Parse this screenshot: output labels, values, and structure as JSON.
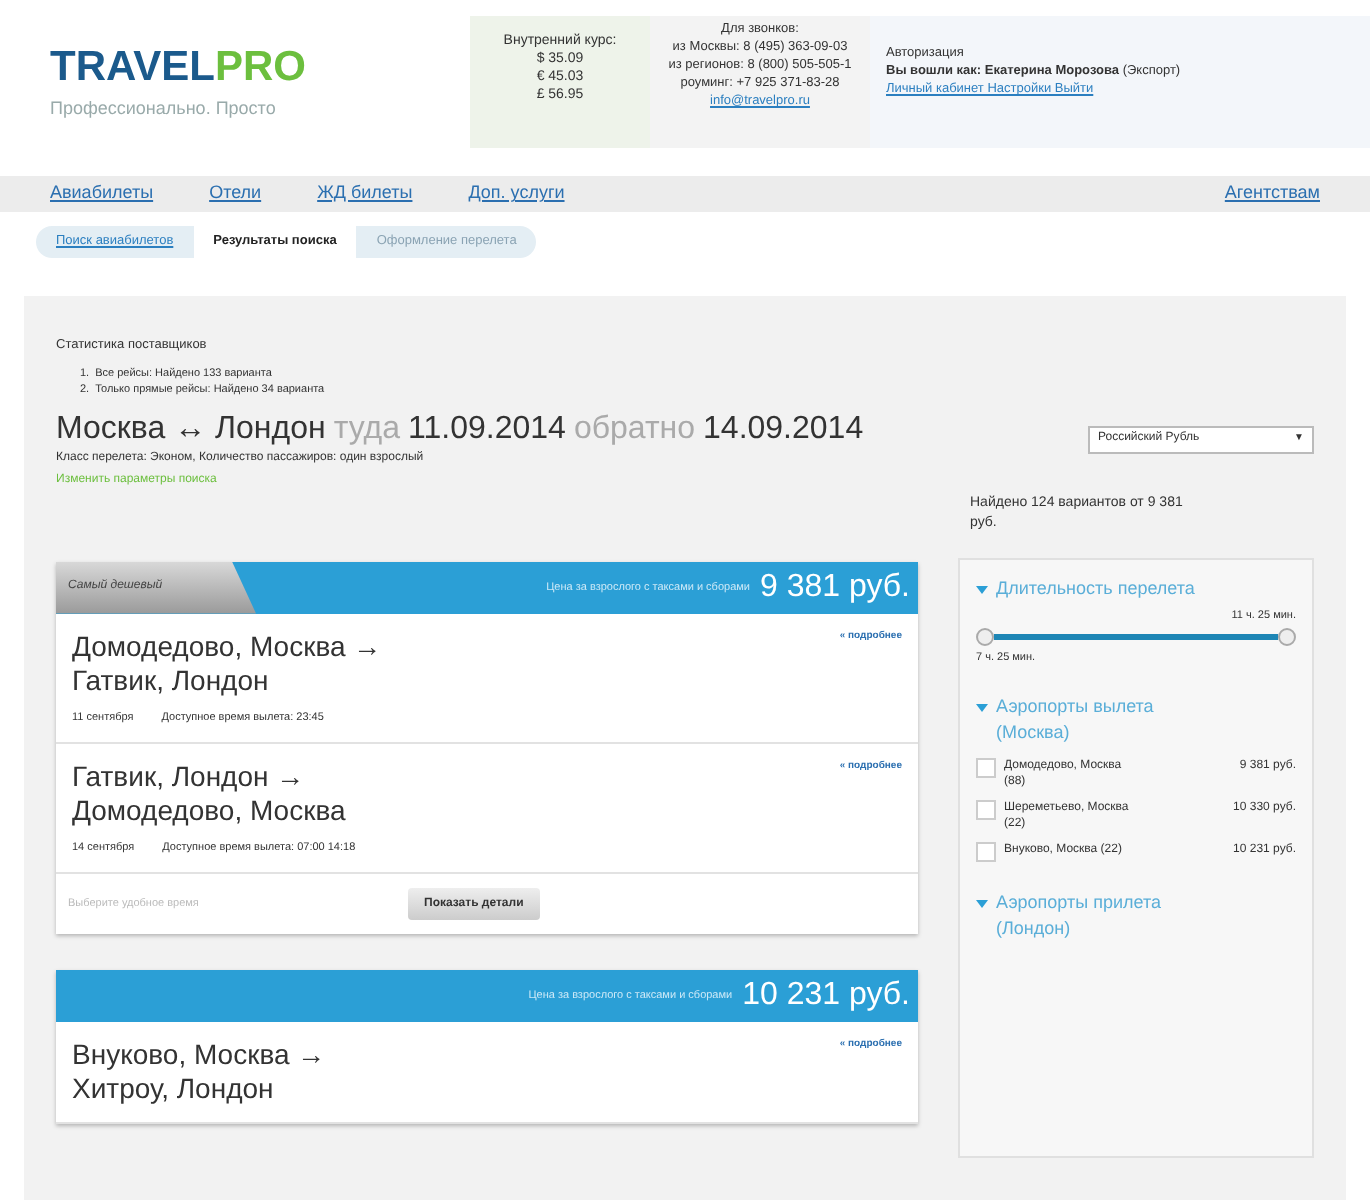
{
  "logo": {
    "part_1": "TRAVEL",
    "part_2": "PRO",
    "tagline": "Профессионально. Просто"
  },
  "rates": {
    "title": "Внутренний курс:",
    "lines": [
      "$ 35.09",
      "€ 45.03",
      "£ 56.95"
    ]
  },
  "contacts": {
    "title": "Для звонков:",
    "lines": [
      "из Москвы: 8 (495) 363-09-03",
      "из регионов: 8 (800) 505-505-1",
      "роуминг: +7 925 371-83-28"
    ],
    "email": "info@travelpro.ru"
  },
  "auth": {
    "title": "Авторизация",
    "label": "Вы вошли как:",
    "user": "Екатерина Морозова",
    "org": "(Экспорт)",
    "links": "Личный кабинет Настройки Выйти"
  },
  "nav": {
    "items": [
      "Авиабилеты",
      "Отели",
      "ЖД билеты",
      "Доп. услуги"
    ],
    "right": "Агентствам"
  },
  "breadcrumbs": [
    {
      "label": "Поиск авиабилетов",
      "selected": false,
      "disabled": false
    },
    {
      "label": "Результаты поиска",
      "selected": true,
      "disabled": false
    },
    {
      "label": "Оформление перелета",
      "selected": false,
      "disabled": true
    }
  ],
  "stats": {
    "title": "Статистика поставщиков",
    "items": [
      {
        "number": "1.",
        "text": "Все рейсы: Найдено 133 варианта"
      },
      {
        "number": "2.",
        "text": "Только прямые рейсы: Найдено 34 варианта"
      }
    ]
  },
  "route": {
    "from_to": "Москва ↔ Лондон",
    "there_label": "туда",
    "there_date": "11.09.2014",
    "back_label": "обратно",
    "back_date": "14.09.2014",
    "details": "Класс перелета: Эконом, Количество пассажиров: один взрослый",
    "change_link": "Изменить параметры поиска"
  },
  "currency": {
    "value": "Российский Рубль",
    "arrow": "▼"
  },
  "found": "Найдено 124 вариантов от 9 381 руб.",
  "offers": [
    {
      "tag": "Самый дешевый",
      "price_label": "Цена за взрослого с таксами и сборами",
      "price": "9 381 руб.",
      "segments": [
        {
          "route_1": "Домодедово, Москва →",
          "route_2": "Гатвик, Лондон",
          "link": "« подробнее",
          "date": "11 сентября",
          "times": "Доступное время вылета: 23:45"
        },
        {
          "route_1": "Гатвик, Лондон →",
          "route_2": "Домодедово, Москва",
          "link": "« подробнее",
          "date": "14 сентября",
          "times": "Доступное время вылета: 07:00 14:18"
        }
      ],
      "footer_note": "Выберите удобное время",
      "button": "Показать детали"
    },
    {
      "price_label": "Цена за взрослого с таксами и сборами",
      "price": "10 231 руб.",
      "segments": [
        {
          "route_1": "Внуково, Москва →",
          "route_2": "Хитроу, Лондон",
          "link": "« подробнее"
        }
      ]
    }
  ],
  "filters": [
    {
      "kind": "slider",
      "title": "Длительность перелета",
      "expanded": true,
      "max_label": "11 ч. 25 мин.",
      "min_label": "7 ч. 25 мин.",
      "level": 1
    },
    {
      "kind": "checklist",
      "title": "Аэропорты вылета (Москва)",
      "expanded": true,
      "options": [
        {
          "label": "Домодедово, Москва (88)",
          "price": "9 381 руб.",
          "checked": false
        },
        {
          "label": "Шереметьево, Москва (22)",
          "price": "10 330 руб.",
          "checked": false
        },
        {
          "label": "Внуково, Москва (22)",
          "price": "10 231 руб.",
          "checked": false
        }
      ]
    },
    {
      "kind": "checklist",
      "title": "Аэропорты прилета (Лондон)",
      "expanded": true
    }
  ]
}
